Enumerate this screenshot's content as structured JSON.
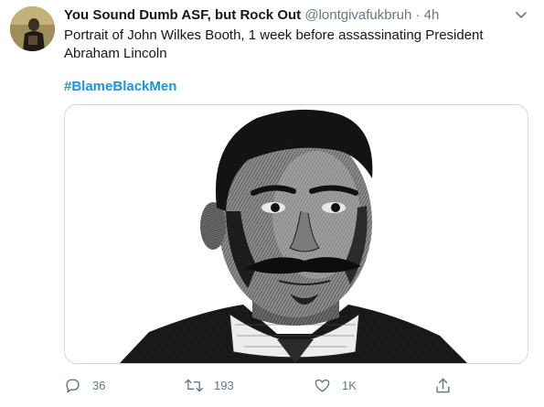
{
  "tweet": {
    "author": {
      "display_name": "You Sound Dumb ASF, but Rock Out",
      "handle": "@lontgivafukbruh",
      "separator": "·",
      "time": "4h"
    },
    "text": "Portrait of John Wilkes Booth, 1 week before assassinating President Abraham Lincoln",
    "hashtag": "#BlameBlackMen",
    "actions": {
      "reply_count": "36",
      "retweet_count": "193",
      "like_count": "1K"
    }
  },
  "icons": {
    "avatar": "avatar-photo",
    "menu": "chevron-down-icon",
    "reply": "reply-icon",
    "retweet": "retweet-icon",
    "like": "heart-icon",
    "share": "share-icon"
  },
  "colors": {
    "hashtag": "#1b95e0",
    "secondary_text": "#657786",
    "border": "#ccd6dd"
  }
}
